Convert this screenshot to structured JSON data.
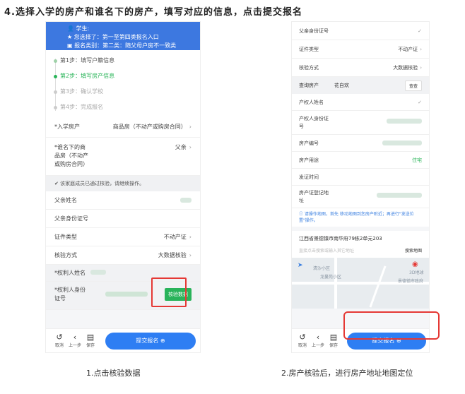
{
  "heading": "4.选择入学的房产和谁名下的房产，填写对应的信息，点击提交报名",
  "phone1": {
    "banner": {
      "student_label": "学生:",
      "choice": "您选择了：第一至第四类报名入口",
      "category": "报名类别：第二类：随父母户房不一致类"
    },
    "steps": [
      {
        "label": "第1步：填写户籍信息",
        "state": "done"
      },
      {
        "label": "第2步：填写房产信息",
        "state": "active"
      },
      {
        "label": "第3步：确认学校",
        "state": "todo"
      },
      {
        "label": "第4步：完成报名",
        "state": "todo"
      }
    ],
    "enroll_property": {
      "label": "*入学房产",
      "value": "商品房（不动产或购房合同）"
    },
    "owner_under": {
      "label": "*谁名下的商品房（不动产或购房合同）",
      "value": "父亲"
    },
    "notice": "✔ 该家庭成员已通过核验，请继续操作。",
    "father_name": {
      "label": "父亲姓名"
    },
    "father_id": {
      "label": "父亲身份证号"
    },
    "cert_type": {
      "label": "证件类型",
      "value": "不动产证"
    },
    "verify_method": {
      "label": "核验方式",
      "value": "大数据核验"
    },
    "right_holder_name": {
      "label": "*权利人姓名"
    },
    "right_holder_id": {
      "label": "*权利人身份证号"
    },
    "verify_button": "核验数据",
    "bottom": {
      "cancel": "取消",
      "prev": "上一步",
      "save": "保存",
      "submit": "提交报名 ⊕"
    }
  },
  "phone2": {
    "father_id": {
      "label": "父亲身份证号"
    },
    "cert_type": {
      "label": "证件类型",
      "value": "不动产证"
    },
    "verify_method": {
      "label": "核验方式",
      "value": "大数据核验"
    },
    "query": {
      "label": "查询房产",
      "value": "花自欢",
      "button": "查查"
    },
    "owner_name": {
      "label": "产权人姓名"
    },
    "owner_id": {
      "label": "产权人身份证号"
    },
    "house_no": {
      "label": "房产编号"
    },
    "usage": {
      "label": "房产用途",
      "value": "住宅"
    },
    "issue_time": {
      "label": "发证时间"
    },
    "reg_addr": {
      "label": "房产证登记地址"
    },
    "tip": "ⓘ 请操作地图，首先 移动地图到您房产附近；再进行\"发送位置\"操作。",
    "address": "江西省景德镇市南华府79栋2单元203",
    "search_placeholder": "直接点击搜索或输入其它地址",
    "search_button": "搜索地图",
    "map_labels": {
      "a": "清沙小区",
      "b": "龙蔓苑小区",
      "c": "3D地球",
      "d": "景德镇市政府"
    },
    "bottom": {
      "cancel": "取消",
      "prev": "上一步",
      "save": "保存",
      "submit": "提交报名 ⊕"
    }
  },
  "captions": {
    "left": "1.点击核验数据",
    "right": "2.房产核验后，进行房产地址地图定位"
  }
}
